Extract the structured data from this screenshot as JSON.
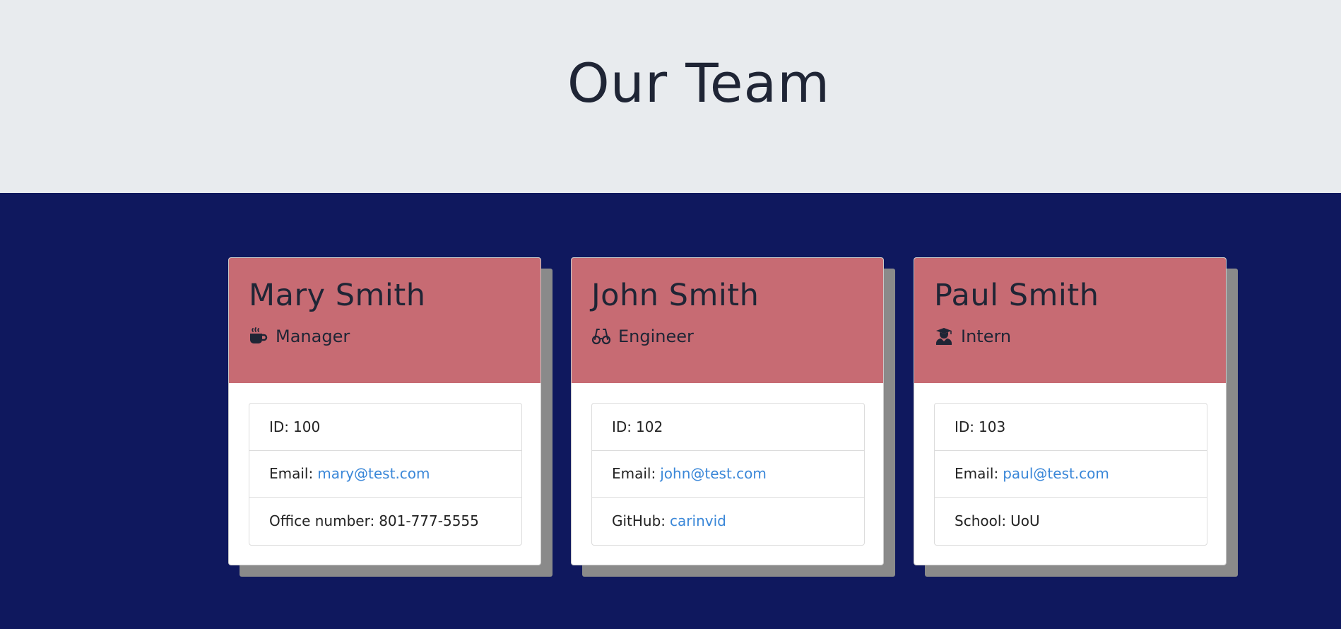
{
  "header": {
    "title": "Our Team"
  },
  "colors": {
    "header_bg": "#e8ebee",
    "main_bg": "#0f185e",
    "card_header_bg": "#c76b73",
    "link": "#3a87d8",
    "shadow": "#8a8a8a"
  },
  "cards": [
    {
      "name": "Mary Smith",
      "role": "Manager",
      "role_icon": "mug-icon",
      "id_label": "ID:",
      "id": "100",
      "email_label": "Email:",
      "email": "mary@test.com",
      "extra_label": "Office number:",
      "extra_value": "801-777-5555"
    },
    {
      "name": "John Smith",
      "role": "Engineer",
      "role_icon": "glasses-icon",
      "id_label": "ID:",
      "id": "102",
      "email_label": "Email:",
      "email": "john@test.com",
      "extra_label": "GitHub:",
      "extra_value": "carinvid"
    },
    {
      "name": "Paul Smith",
      "role": "Intern",
      "role_icon": "graduate-icon",
      "id_label": "ID:",
      "id": "103",
      "email_label": "Email:",
      "email": "paul@test.com",
      "extra_label": "School:",
      "extra_value": "UoU"
    }
  ]
}
